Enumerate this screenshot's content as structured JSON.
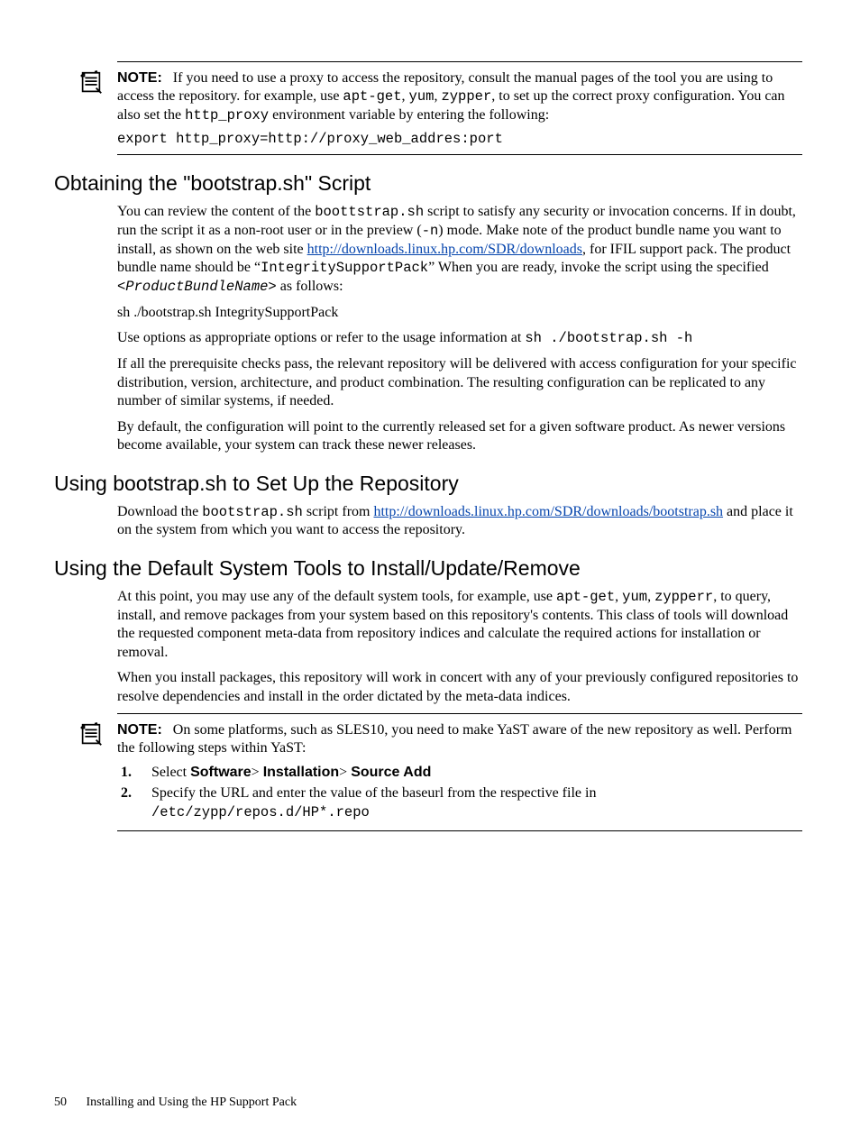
{
  "note1": {
    "label": "NOTE:",
    "t1a": "If you need to use a proxy to access the repository, consult the manual pages of the tool you are using to access the repository. for example, use ",
    "c1": "apt-get",
    "t1b": ", ",
    "c2": "yum",
    "t1c": ", ",
    "c3": "zypper",
    "t1d": ", to set up the correct proxy configuration. You can also set the ",
    "c4": "http_proxy",
    "t1e": " environment variable by entering the following:",
    "cmd": "export http_proxy=http://proxy_web_addres:port"
  },
  "s1": {
    "title": "Obtaining the \"bootstrap.sh\" Script",
    "p1a": "You can review the content of the ",
    "p1c1": "boottstrap.sh",
    "p1b": " script to satisfy any security or invocation concerns. If in doubt, run the script it as a non-root user or in the preview (",
    "p1c2": "-n",
    "p1c": ") mode. Make note of the product bundle name you want to install, as shown on the web site ",
    "link1": "http://downloads.linux.hp.com/SDR/downloads",
    "p1d": ", for IFIL support pack. The product bundle name should be “",
    "p1c3": "IntegritySupportPack",
    "p1e": "” When you are ready, invoke the script using the specified ",
    "p1c4": "<ProductBundleName>",
    "p1f": " as follows:",
    "p2": "sh ./bootstrap.sh IntegritySupportPack",
    "p3a": "Use options as appropriate options or refer to the usage information at ",
    "p3c1": "sh ./bootstrap.sh -h",
    "p4": "If all the prerequisite checks pass, the relevant repository will be delivered with access configuration for your specific distribution, version, architecture, and product combination. The resulting configuration can be replicated to any number of similar systems, if needed.",
    "p5": "By default, the configuration will point to the currently released set for a given software product. As newer versions become available, your system can track these newer releases."
  },
  "s2": {
    "title": "Using bootstrap.sh to Set Up the Repository",
    "p1a": "Download the ",
    "p1c1": "bootstrap.sh",
    "p1b": " script from ",
    "link1": "http://downloads.linux.hp.com/SDR/downloads/bootstrap.sh",
    "p1c": " and place it on the system from which you want to access the repository."
  },
  "s3": {
    "title": "Using the Default System Tools to Install/Update/Remove",
    "p1a": "At this point, you may use any of the default system tools, for example, use ",
    "c1": "apt-get",
    "p1b": ", ",
    "c2": "yum",
    "p1c": ", ",
    "c3": "zypperr",
    "p1d": ", to query, install, and remove packages from your system based on this repository's contents. This class of tools will download the requested component meta-data from repository indices and calculate the required actions for installation or removal.",
    "p2": "When you install packages, this repository will work in concert with any of your previously configured repositories to resolve dependencies and install in the order dictated by the meta-data indices."
  },
  "note2": {
    "label": "NOTE:",
    "t1": "On some platforms, such as SLES10, you need to make YaST aware of the new repository as well. Perform the following steps within YaST:",
    "li1n": "1.",
    "li1a": "Select ",
    "li1b1": "Software",
    "li1s1": "> ",
    "li1b2": "Installation",
    "li1s2": "> ",
    "li1b3": "Source Add",
    "li2n": "2.",
    "li2a": "Specify the URL and enter the value of the baseurl from the respective file in ",
    "li2c1": "/etc/zypp/repos.d/HP*.repo"
  },
  "footer": {
    "page": "50",
    "chapter": "Installing and Using the HP Support Pack"
  }
}
